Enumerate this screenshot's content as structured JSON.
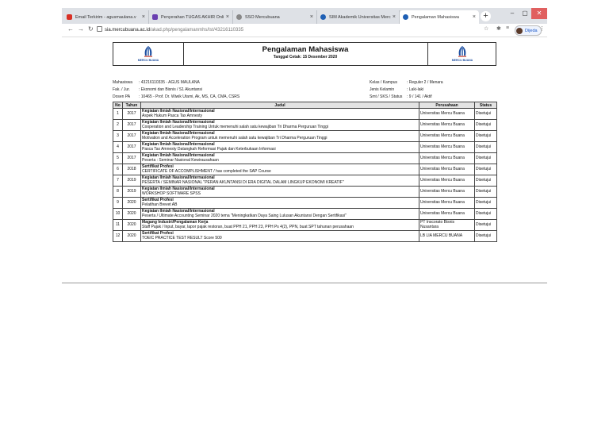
{
  "browser": {
    "tabs": [
      {
        "title": "Email Terkirim - agusmaulana.v",
        "color": "#d93025"
      },
      {
        "title": "Penyerahan TUGAS AKHIR Onli",
        "color": "#6a3fb0"
      },
      {
        "title": "SSO Mercubuana",
        "color": "#888888"
      },
      {
        "title": "SIM Akademik Universitas Merc",
        "color": "#1e5fb4"
      },
      {
        "title": "Pengalaman Mahasiswa",
        "color": "#1e5fb4"
      }
    ],
    "url_host": "sia.mercubuana.ac.id",
    "url_path": "/akad.php/pengalamanmhs/lst/43216110335",
    "profile_label": "Dijeda"
  },
  "report": {
    "title": "Pengalaman Mahasiswa",
    "subtitle": "Tanggal Cetak: 15 Desember 2020",
    "logo_text": "MERCU BUANA"
  },
  "student": {
    "left": [
      {
        "label": "Mahasiswa",
        "value": ": 43216110335 - AGUS MAULANA"
      },
      {
        "label": "Fak. / Jur.",
        "value": ": Ekonomi dan Bisnis / S1 Akuntansi"
      },
      {
        "label": "Dosen PA",
        "value": ": 10465 - Prof. Dr. Wiwik Utami, Ak, MS, CA, CMA, CSRS"
      }
    ],
    "right": [
      {
        "label": "Kelas / Kampus",
        "value": ": Reguler 2 / Menara"
      },
      {
        "label": "Jenis Kelamin",
        "value": ": Laki-laki"
      },
      {
        "label": "Smt / SKS / Status",
        "value": ": 9 / 141 / Aktif"
      }
    ]
  },
  "table": {
    "headers": [
      "No",
      "Tahun",
      "Judul",
      "Perusahaan",
      "Status"
    ],
    "rows": [
      {
        "no": "1",
        "year": "2017",
        "cat": "Kegiatan Ilmiah Nasional/Internasional",
        "desc": "Aspek Hukum Pasca Tax Amnesty",
        "company": "Universitas Mercu Buana",
        "status": "Disetujui"
      },
      {
        "no": "2",
        "year": "2017",
        "cat": "Kegiatan Ilmiah Nasional/Internasional",
        "desc": "Cooperation and Leadership Training Untuk memenuhi salah satu kewajiban Tri Dharma Perguruan Tinggi",
        "company": "Universitas Mercu Buana",
        "status": "Disetujui"
      },
      {
        "no": "3",
        "year": "2017",
        "cat": "Kegiatan Ilmiah Nasional/Internasional",
        "desc": "Motivation and Acceleration Program untuk memenuhi salah satu kewajiban Tri Dharma Perguruan Tinggi",
        "company": "Universitas Mercu Buana",
        "status": "Disetujui"
      },
      {
        "no": "4",
        "year": "2017",
        "cat": "Kegiatan Ilmiah Nasional/Internasional",
        "desc": "Pasca Tax Amnesty Datangkah Reformasi Pajak dan Keterbukaan Informasi",
        "company": "Universitas Mercu Buana",
        "status": "Disetujui"
      },
      {
        "no": "5",
        "year": "2017",
        "cat": "Kegiatan Ilmiah Nasional/Internasional",
        "desc": "Peserta : Seminar Nasional Kewirausahaan",
        "company": "Universitas Mercu Buana",
        "status": "Disetujui"
      },
      {
        "no": "6",
        "year": "2018",
        "cat": "Sertifikat Profesi",
        "desc": "CERTIFICATE OF ACCOMPLISHMENT / has completed the SAP Course",
        "company": "Universitas Mercu Buana",
        "status": "Disetujui"
      },
      {
        "no": "7",
        "year": "2019",
        "cat": "Kegiatan Ilmiah Nasional/Internasional",
        "desc": "PESERTA / SEMINAR NASIONAL \"PERAN AKUNTANSI DI ERA DIGITAL DALAM LINGKUP EKONOMI KREATIF\"",
        "company": "Universitas Mercu Buana",
        "status": "Disetujui"
      },
      {
        "no": "8",
        "year": "2019",
        "cat": "Kegiatan Ilmiah Nasional/Internasional",
        "desc": "WORKSHOP SOFTWARE SPSS",
        "company": "Universitas Mercu Buana",
        "status": "Disetujui"
      },
      {
        "no": "9",
        "year": "2020",
        "cat": "Sertifikat Profesi",
        "desc": "Pelatihan Brevet AB",
        "company": "Universitas Mercu Buana",
        "status": "Disetujui"
      },
      {
        "no": "10",
        "year": "2020",
        "cat": "Kegiatan Ilmiah Nasional/Internasional",
        "desc": "Peserta / Ultimate Accounting Seminar 2020 tema \"Meningkatkan Daya Saing Lulusan Akuntansi Dengan Sertifikasi\"",
        "company": "Universitas Mercu Buana",
        "status": "Disetujui"
      },
      {
        "no": "11",
        "year": "2020",
        "cat": "Magang Industri/Pengalaman Kerja",
        "desc": "Staff Pajak / Input, bayar, lapor pajak restoran, buat PPH 21, PPH 23, PPH Ps 4(2), PPN, buat SPT tahunan perusahaan",
        "company": "PT Inscorato Bisnis Nusantara",
        "status": "Disetujui"
      },
      {
        "no": "12",
        "year": "2020",
        "cat": "Sertifikat Profesi",
        "desc": "TOEIC PRACTICE TEST RESULT Score 500",
        "company": "LB LIA MERCU BUANA",
        "status": "Disetujui"
      }
    ]
  }
}
